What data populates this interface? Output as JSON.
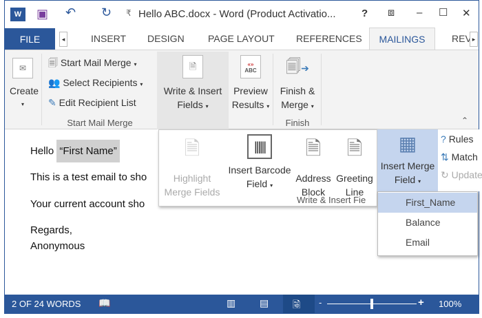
{
  "title_bar": {
    "title": "Hello ABC.docx - Word (Product Activatio...",
    "help": "?",
    "minimize": "–",
    "maximize": "☐",
    "close": "✕"
  },
  "tabs": {
    "file": "FILE",
    "insert": "INSERT",
    "design": "DESIGN",
    "page_layout": "PAGE LAYOUT",
    "references": "REFERENCES",
    "mailings": "MAILINGS",
    "review": "REV"
  },
  "ribbon": {
    "create": "Create",
    "start_mail_merge": "Start Mail Merge",
    "select_recipients": "Select Recipients",
    "edit_recipient_list": "Edit Recipient List",
    "group_start": "Start Mail Merge",
    "write_insert_1": "Write & Insert",
    "write_insert_2": "Fields",
    "preview_1": "Preview",
    "preview_2": "Results",
    "finish_1": "Finish &",
    "finish_2": "Merge",
    "group_finish": "Finish"
  },
  "write_panel": {
    "highlight_1": "Highlight",
    "highlight_2": "Merge Fields",
    "barcode_1": "Insert Barcode",
    "barcode_2": "Field",
    "address_1": "Address",
    "address_2": "Block",
    "greeting_1": "Greeting",
    "greeting_2": "Line",
    "merge_1": "Insert Merge",
    "merge_2": "Field",
    "rules": "Rules",
    "match": "Match",
    "update": "Update",
    "group": "Write & Insert Fie"
  },
  "merge_menu": [
    "First_Name",
    "Balance",
    "Email"
  ],
  "document": {
    "hello": "Hello ",
    "field": "“First Name”",
    "line2": "This is a test email to sho",
    "line3": "Your current account sho",
    "regards": "Regards,",
    "name": "Anonymous"
  },
  "status": {
    "words": "2 OF 24 WORDS",
    "zoom": "100%",
    "zoom_percent": 100
  }
}
